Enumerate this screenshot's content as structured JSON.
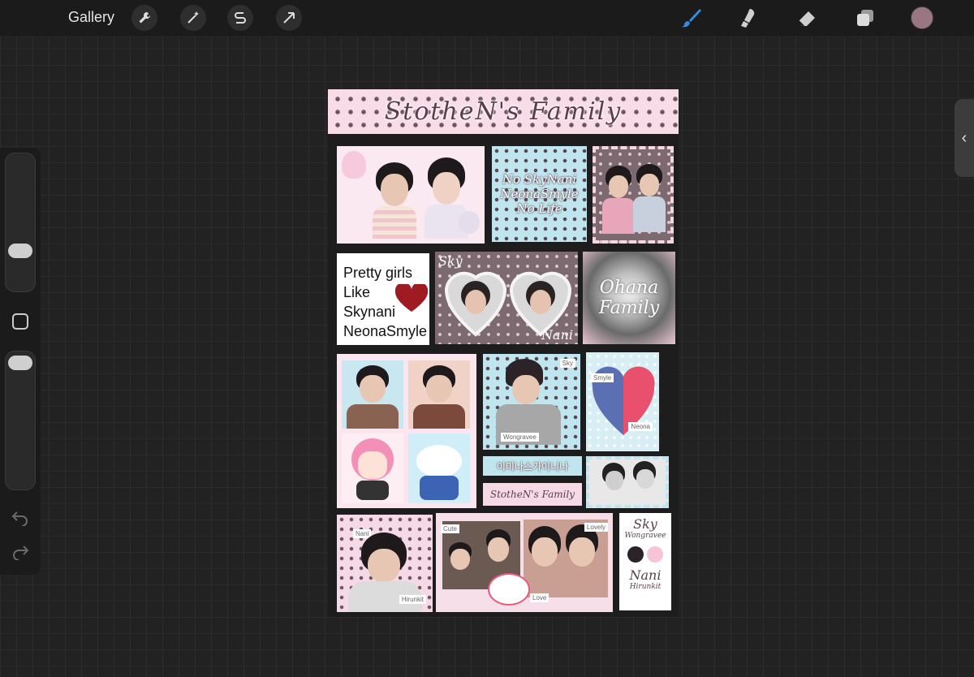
{
  "topbar": {
    "gallery_label": "Gallery",
    "tools_left": [
      "wrench-icon",
      "magic-wand-icon",
      "selection-s-icon",
      "arrow-transform-icon"
    ],
    "tools_right": [
      "brush-icon",
      "smudge-icon",
      "eraser-icon",
      "layers-icon"
    ],
    "active_tool": "brush-icon",
    "brush_color": "#2f8fe6",
    "current_color": "#9a7682"
  },
  "sidebar": {
    "size_slider_level": 0.25,
    "opacity_slider_level": 0.05,
    "undo": "undo-icon",
    "redo": "redo-icon"
  },
  "canvas": {
    "banner_title": "StotheN's Family",
    "card_text": {
      "lines": [
        "No SkyNani",
        "NeonaSmyle",
        "No Life"
      ]
    },
    "pretty_girls": {
      "lines": [
        "Pretty girls",
        "Like",
        "Skynani",
        "NeonaSmyle"
      ]
    },
    "locket": {
      "left": "Sky",
      "right": "Nani"
    },
    "ohana": {
      "line1": "Ohana",
      "line2": "Family"
    },
    "heart_tags": {
      "top": "Smyle",
      "bottom": "Neona"
    },
    "kuromi_tags": {
      "top": "Sky",
      "bottom": "Wongravee"
    },
    "hangul_strip": "이미나스가이니나",
    "family_strip": "StotheN's Family",
    "bottom_tags": {
      "nani": "Nani",
      "hirunkit": "Hirunkit",
      "cute": "Cute",
      "lovely": "Lovely",
      "love": "Love"
    },
    "name_card": {
      "sky": "Sky",
      "wongravee": "Wongravee",
      "nani": "Nani",
      "hirunkit": "Hirunkit"
    },
    "colors": {
      "pink": "#f6d9e6",
      "blue": "#bfe6ef",
      "mauve": "#7d6a71",
      "heart": "#9e1b22"
    }
  }
}
